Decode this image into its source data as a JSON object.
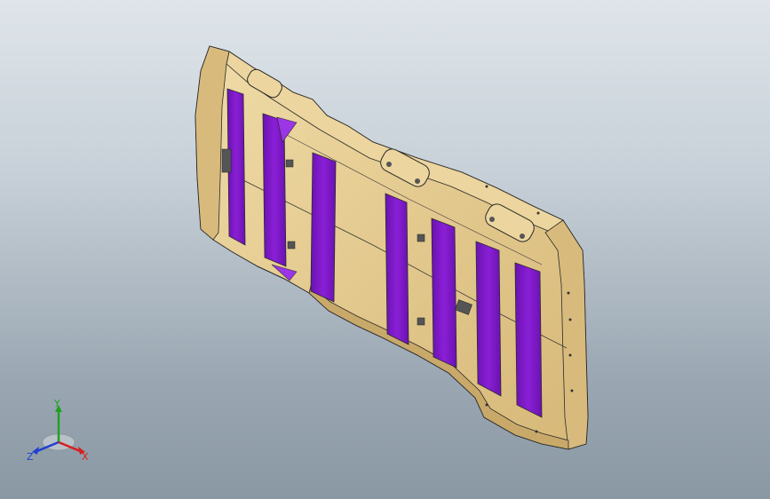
{
  "viewport": {
    "background_top": "#dfe5ea",
    "background_bottom": "#8a98a4"
  },
  "model": {
    "body_color": "#e3c98e",
    "shade_color": "#c9a96a",
    "edge_color": "#2a2a2a",
    "pad_color": "#8a1fd6",
    "pad_count": 9
  },
  "triad": {
    "x_label": "X",
    "y_label": "Y",
    "z_label": "Z",
    "x_color": "#d42020",
    "y_color": "#22a022",
    "z_color": "#2040d0"
  }
}
